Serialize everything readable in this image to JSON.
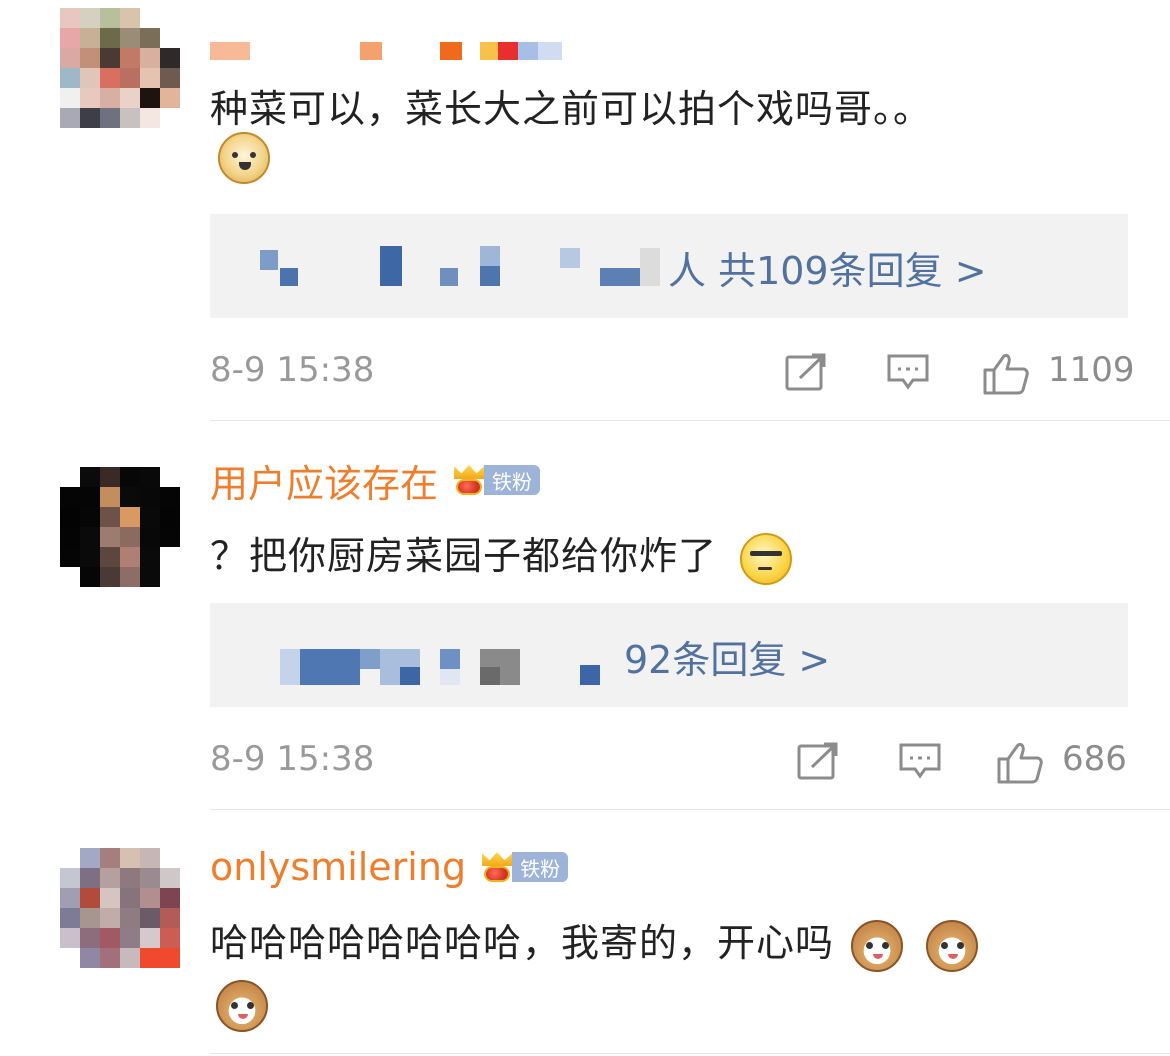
{
  "comments": [
    {
      "username": "",
      "badge_label": "",
      "text": "种菜可以，菜长大之前可以拍个戏吗哥。。",
      "emojis": [
        "doge"
      ],
      "replies_text": "人 共109条回复 >",
      "time": "8-9 15:38",
      "likes": "1109"
    },
    {
      "username": "用户应该存在",
      "badge_label": "铁粉",
      "text": "？把你厨房菜园子都给你炸了",
      "emojis": [
        "cool"
      ],
      "replies_text": "92条回复 >",
      "time": "8-9 15:38",
      "likes": "686"
    },
    {
      "username": "onlysmilering",
      "badge_label": "铁粉",
      "text": "哈哈哈哈哈哈哈哈，我寄的，开心吗",
      "emojis": [
        "cat",
        "cat",
        "cat"
      ],
      "time": "",
      "likes": ""
    }
  ],
  "icons": {
    "repost": "repost-icon",
    "comment": "comment-icon",
    "like": "thumbs-up-icon",
    "crown": "crown-icon"
  },
  "colors": {
    "username": "#ee7e2c",
    "reply_link": "#51729f",
    "meta": "#999999",
    "badge": "#9db3d8"
  }
}
